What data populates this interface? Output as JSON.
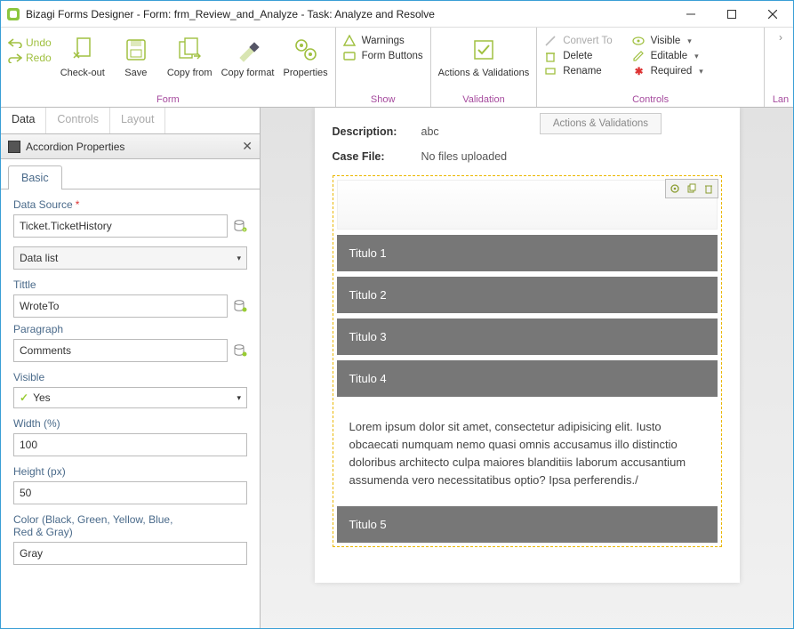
{
  "window": {
    "title": "Bizagi Forms Designer  - Form: frm_Review_and_Analyze - Task:  Analyze and Resolve"
  },
  "ribbon": {
    "undo": "Undo",
    "redo": "Redo",
    "checkout": "Check-out",
    "save": "Save",
    "copyfrom": "Copy from",
    "copyformat": "Copy format",
    "properties": "Properties",
    "group_form": "Form",
    "warnings": "Warnings",
    "formbuttons": "Form Buttons",
    "group_show": "Show",
    "actions_validations": "Actions & Validations",
    "group_validation": "Validation",
    "convertto": "Convert To",
    "delete": "Delete",
    "rename": "Rename",
    "visible": "Visible",
    "editable": "Editable",
    "required": "Required",
    "group_controls": "Controls",
    "group_lan": "Lan"
  },
  "leftpanel": {
    "tabs": {
      "data": "Data",
      "controls": "Controls",
      "layout": "Layout"
    },
    "section_title": "Accordion Properties",
    "basic_tab": "Basic",
    "ds_label": "Data Source",
    "ds_value": "Ticket.TicketHistory",
    "dl_label": "Data list",
    "title_label": "Tittle",
    "title_value": "WroteTo",
    "paragraph_label": "Paragraph",
    "paragraph_value": "Comments",
    "visible_label": "Visible",
    "visible_value": "Yes",
    "width_label": "Width (%)",
    "width_value": "100",
    "height_label": "Height (px)",
    "height_value": "50",
    "color_label": "Color (Black, Green, Yellow, Blue, Red & Gray)",
    "color_value": "Gray"
  },
  "canvas": {
    "actions_tooltip": "Actions & Validations",
    "description_label": "Description:",
    "description_value": "abc",
    "casefile_label": "Case File:",
    "casefile_value": "No files uploaded",
    "acc": [
      "Titulo 1",
      "Titulo 2",
      "Titulo 3",
      "Titulo 4",
      "Titulo 5"
    ],
    "lorem": "Lorem ipsum dolor sit amet, consectetur adipisicing elit. Iusto obcaecati numquam nemo quasi omnis accusamus illo distinctio doloribus architecto culpa maiores blanditiis laborum accusantium assumenda vero necessitatibus optio? Ipsa perferendis./"
  }
}
